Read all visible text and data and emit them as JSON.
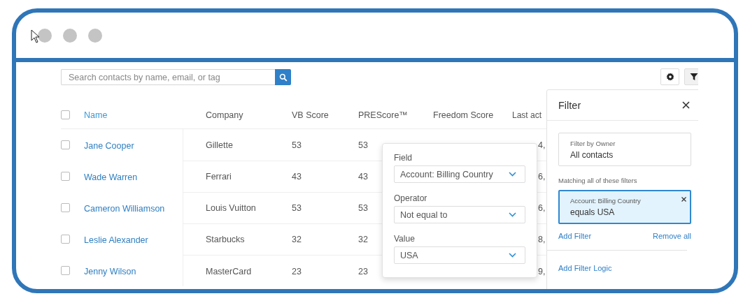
{
  "search": {
    "placeholder": "Search contacts by name, email, or tag"
  },
  "table": {
    "select_all": {
      "checked": false
    },
    "columns": [
      {
        "label": "Name",
        "sorted": true
      },
      {
        "label": "Company",
        "sorted": false
      },
      {
        "label": "VB Score",
        "sorted": false
      },
      {
        "label": "PREScore™",
        "sorted": false
      },
      {
        "label": "Freedom Score",
        "sorted": false
      },
      {
        "label": "Last act",
        "sorted": false
      }
    ],
    "rows": [
      {
        "checked": false,
        "name": "Jane Cooper",
        "company": "Gillette",
        "vb_score": "53",
        "prescore": "53",
        "last_activity": "4,"
      },
      {
        "checked": false,
        "name": "Wade Warren",
        "company": "Ferrari",
        "vb_score": "43",
        "prescore": "43",
        "last_activity": "6,"
      },
      {
        "checked": false,
        "name": "Cameron Williamson",
        "company": "Louis Vuitton",
        "vb_score": "53",
        "prescore": "53",
        "last_activity": "6,"
      },
      {
        "checked": false,
        "name": "Leslie Alexander",
        "company": "Starbucks",
        "vb_score": "32",
        "prescore": "32",
        "last_activity": "8,"
      },
      {
        "checked": false,
        "name": "Jenny Wilson",
        "company": "MasterCard",
        "vb_score": "23",
        "prescore": "23",
        "last_activity": "9,"
      }
    ]
  },
  "filter_editor": {
    "fields": [
      {
        "label": "Field",
        "value": "Account: Billing Country"
      },
      {
        "label": "Operator",
        "value": "Not equal to"
      },
      {
        "label": "Value",
        "value": "USA"
      }
    ]
  },
  "filter_panel": {
    "title": "Filter",
    "owner": {
      "label": "Filter by Owner",
      "value": "All contacts"
    },
    "matching_label": "Matching all of these filters",
    "filters": [
      {
        "field": "Account: Billing Country",
        "condition": "equals USA",
        "selected": true
      }
    ],
    "add_filter": "Add Filter",
    "remove_all": "Remove all",
    "add_logic": "Add Filter Logic"
  }
}
